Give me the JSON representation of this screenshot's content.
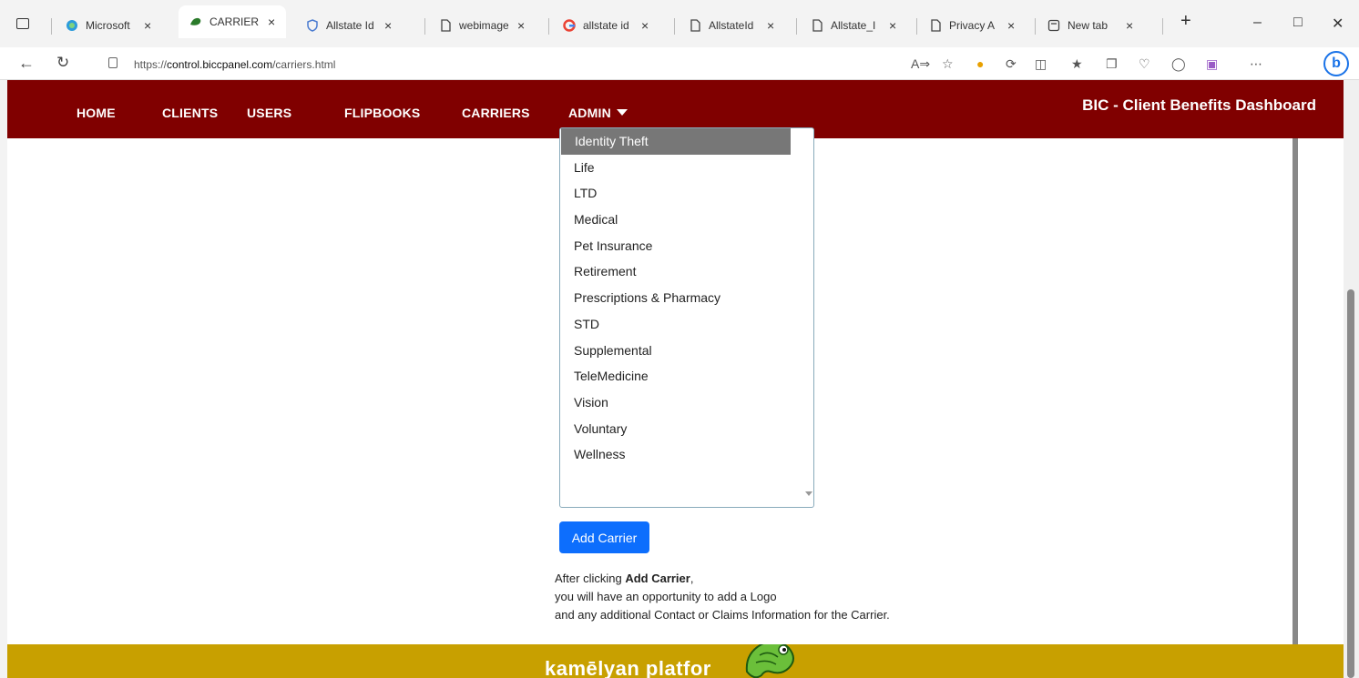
{
  "browser": {
    "tabs": [
      {
        "label": "Microsoft",
        "icon": "edge-icon"
      },
      {
        "label": "CARRIERS",
        "icon": "chameleon-icon",
        "active": true
      },
      {
        "label": "Allstate Id",
        "icon": "shield-icon"
      },
      {
        "label": "webimage",
        "icon": "page-icon"
      },
      {
        "label": "allstate id",
        "icon": "google-icon"
      },
      {
        "label": "AllstateId",
        "icon": "page-icon"
      },
      {
        "label": "Allstate_I",
        "icon": "page-icon"
      },
      {
        "label": "Privacy A",
        "icon": "page-icon"
      },
      {
        "label": "New tab",
        "icon": "newtab-icon"
      }
    ],
    "close_glyph": "×",
    "new_tab_glyph": "+",
    "url_prefix": "https://",
    "url_host": "control.biccpanel.com",
    "url_path": "/carriers.html"
  },
  "nav": {
    "home": "HOME",
    "clients": "CLIENTS",
    "users": "USERS",
    "flipbooks": "FLIPBOOKS",
    "carriers": "CARRIERS",
    "admin": "ADMIN",
    "brand": "BIC - Client Benefits Dashboard"
  },
  "categories": {
    "selected": "Identity Theft",
    "options": [
      "Identity Theft",
      "Life",
      "LTD",
      "Medical",
      "Pet Insurance",
      "Retirement",
      "Prescriptions & Pharmacy",
      "STD",
      "Supplemental",
      "TeleMedicine",
      "Vision",
      "Voluntary",
      "Wellness"
    ]
  },
  "form": {
    "add_button": "Add Carrier",
    "help_line1_pre": "After clicking ",
    "help_line1_bold": "Add Carrier",
    "help_line1_post": ",",
    "help_line2": "you will have an opportunity to add a Logo",
    "help_line3": "and any additional Contact or Claims Information for the Carrier."
  },
  "footer": {
    "text": "kamēlyan platfor"
  },
  "colors": {
    "navbar": "#800000",
    "footer": "#c8a000",
    "primary_button": "#0d6efd",
    "selected_option": "#777777"
  }
}
